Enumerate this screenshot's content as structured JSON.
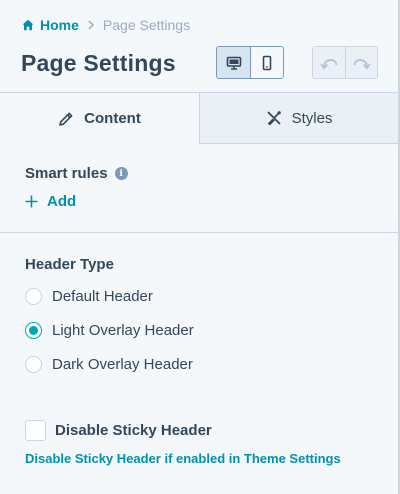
{
  "breadcrumb": {
    "home_label": "Home",
    "current_label": "Page Settings"
  },
  "page_title": "Page Settings",
  "device_toggle": {
    "selected": "desktop",
    "options": [
      "desktop",
      "mobile"
    ]
  },
  "history": {
    "undo_enabled": false,
    "redo_enabled": false
  },
  "tabs": [
    {
      "label": "Content",
      "icon": "pencil-icon",
      "active": true
    },
    {
      "label": "Styles",
      "icon": "brush-icon",
      "active": false
    }
  ],
  "smart_rules": {
    "label": "Smart rules",
    "add_label": "Add"
  },
  "header_type": {
    "label": "Header Type",
    "options": [
      {
        "label": "Default Header",
        "selected": false
      },
      {
        "label": "Light Overlay Header",
        "selected": true
      },
      {
        "label": "Dark Overlay Header",
        "selected": false
      }
    ]
  },
  "sticky_header": {
    "label": "Disable Sticky Header",
    "checked": false,
    "help_text": "Disable Sticky Header if enabled in Theme Settings"
  },
  "colors": {
    "accent": "#00a4bd",
    "link": "#0091ae",
    "text": "#33475b",
    "background": "#f5f8fa"
  }
}
